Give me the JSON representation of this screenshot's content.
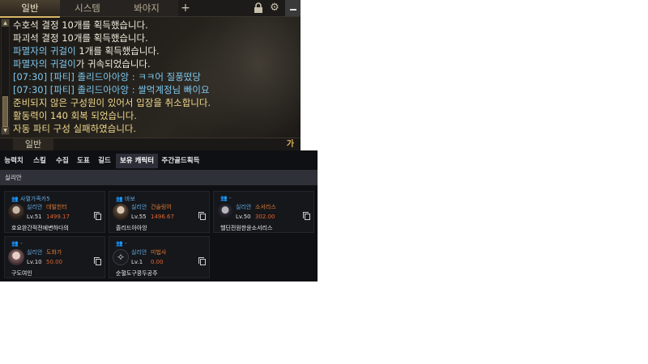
{
  "chat": {
    "tabs": [
      "일반",
      "시스템",
      "봐야지"
    ],
    "add_tab": "+",
    "messages": [
      {
        "parts": [
          {
            "t": "수호석 결정 10개를 획득했습니다.",
            "c": "c-white"
          }
        ]
      },
      {
        "parts": [
          {
            "t": "파괴석 결정 10개를 획득했습니다.",
            "c": "c-white"
          }
        ]
      },
      {
        "parts": [
          {
            "t": "파멸자의 귀걸이",
            "c": "c-blue"
          },
          {
            "t": " 1개를 획득했습니다.",
            "c": "c-white"
          }
        ]
      },
      {
        "parts": [
          {
            "t": "파멸자의 귀걸이",
            "c": "c-blue"
          },
          {
            "t": "가 귀속되었습니다.",
            "c": "c-white"
          }
        ]
      },
      {
        "parts": [
          {
            "t": "[07:30] [파티] 졸리드아아앙 : ㅋㅋ어 질풍떴당",
            "c": "c-party"
          }
        ]
      },
      {
        "parts": [
          {
            "t": "[07:30] [파티] 졸리드아아앙 : 쌀먹계정님 빠이요",
            "c": "c-party"
          }
        ]
      },
      {
        "parts": [
          {
            "t": "준비되지 않은 구성원이 있어서 입장을 취소합니다.",
            "c": "c-yellow"
          }
        ]
      },
      {
        "parts": [
          {
            "t": "활동력이 140 회복 되었습니다.",
            "c": "c-yellow"
          }
        ]
      },
      {
        "parts": [
          {
            "t": "자동 파티 구성 실패하였습니다.",
            "c": "c-yellow"
          }
        ]
      }
    ],
    "input_channel": "일반",
    "ime_indicator": "가"
  },
  "panel": {
    "tabs": [
      "능력치",
      "스킬",
      "수집",
      "도표",
      "길드",
      "보유 캐릭터",
      "주간골드획득"
    ],
    "active_tab": 5,
    "region": "실리안",
    "characters": [
      {
        "family": "사멸가족카5",
        "server": "실리안",
        "class": "데빌헌터",
        "level": "Lv.51",
        "item_level": "1499.17",
        "name": "호요완간적전에변하다의",
        "avatar": "av1"
      },
      {
        "family": "바보",
        "server": "실리안",
        "class": "건슬링어",
        "level": "Lv.55",
        "item_level": "1496.67",
        "name": "졸리드아아앙",
        "avatar": "av2"
      },
      {
        "family": "-",
        "server": "실리안",
        "class": "소서리스",
        "level": "Lv.50",
        "item_level": "302.00",
        "name": "헬딘전원한윤소서리스",
        "avatar": "av3"
      },
      {
        "family": "-",
        "server": "실리안",
        "class": "도화가",
        "level": "Lv.10",
        "item_level": "50.00",
        "name": "구도여인",
        "avatar": "av4"
      },
      {
        "family": "-",
        "server": "실리안",
        "class": "미법사",
        "level": "Lv.1",
        "item_level": "0.00",
        "name": "순혈도구콩두공주",
        "avatar": "av5"
      }
    ]
  },
  "colors": {
    "accent_gold": "#d8b56a",
    "party_blue": "#7ec8ef",
    "system_yellow": "#f0d88c",
    "class_orange": "#e07a32",
    "panel_bg": "#0f1014"
  },
  "icons": [
    "lock-icon",
    "gear-icon",
    "minimize-icon",
    "copy-icon",
    "family-icon",
    "scroll-up-icon",
    "scroll-down-icon"
  ]
}
